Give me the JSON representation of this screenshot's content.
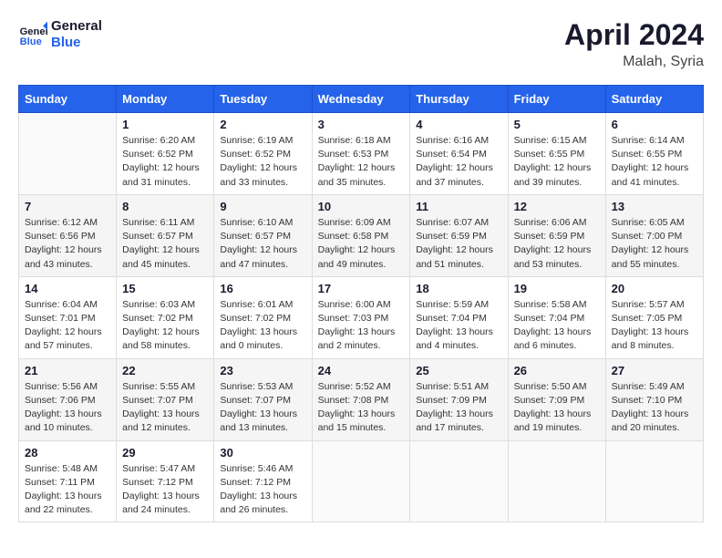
{
  "logo": {
    "line1": "General",
    "line2": "Blue"
  },
  "title": "April 2024",
  "subtitle": "Malah, Syria",
  "header_days": [
    "Sunday",
    "Monday",
    "Tuesday",
    "Wednesday",
    "Thursday",
    "Friday",
    "Saturday"
  ],
  "weeks": [
    [
      {
        "day": "",
        "info": ""
      },
      {
        "day": "1",
        "info": "Sunrise: 6:20 AM\nSunset: 6:52 PM\nDaylight: 12 hours\nand 31 minutes."
      },
      {
        "day": "2",
        "info": "Sunrise: 6:19 AM\nSunset: 6:52 PM\nDaylight: 12 hours\nand 33 minutes."
      },
      {
        "day": "3",
        "info": "Sunrise: 6:18 AM\nSunset: 6:53 PM\nDaylight: 12 hours\nand 35 minutes."
      },
      {
        "day": "4",
        "info": "Sunrise: 6:16 AM\nSunset: 6:54 PM\nDaylight: 12 hours\nand 37 minutes."
      },
      {
        "day": "5",
        "info": "Sunrise: 6:15 AM\nSunset: 6:55 PM\nDaylight: 12 hours\nand 39 minutes."
      },
      {
        "day": "6",
        "info": "Sunrise: 6:14 AM\nSunset: 6:55 PM\nDaylight: 12 hours\nand 41 minutes."
      }
    ],
    [
      {
        "day": "7",
        "info": "Sunrise: 6:12 AM\nSunset: 6:56 PM\nDaylight: 12 hours\nand 43 minutes."
      },
      {
        "day": "8",
        "info": "Sunrise: 6:11 AM\nSunset: 6:57 PM\nDaylight: 12 hours\nand 45 minutes."
      },
      {
        "day": "9",
        "info": "Sunrise: 6:10 AM\nSunset: 6:57 PM\nDaylight: 12 hours\nand 47 minutes."
      },
      {
        "day": "10",
        "info": "Sunrise: 6:09 AM\nSunset: 6:58 PM\nDaylight: 12 hours\nand 49 minutes."
      },
      {
        "day": "11",
        "info": "Sunrise: 6:07 AM\nSunset: 6:59 PM\nDaylight: 12 hours\nand 51 minutes."
      },
      {
        "day": "12",
        "info": "Sunrise: 6:06 AM\nSunset: 6:59 PM\nDaylight: 12 hours\nand 53 minutes."
      },
      {
        "day": "13",
        "info": "Sunrise: 6:05 AM\nSunset: 7:00 PM\nDaylight: 12 hours\nand 55 minutes."
      }
    ],
    [
      {
        "day": "14",
        "info": "Sunrise: 6:04 AM\nSunset: 7:01 PM\nDaylight: 12 hours\nand 57 minutes."
      },
      {
        "day": "15",
        "info": "Sunrise: 6:03 AM\nSunset: 7:02 PM\nDaylight: 12 hours\nand 58 minutes."
      },
      {
        "day": "16",
        "info": "Sunrise: 6:01 AM\nSunset: 7:02 PM\nDaylight: 13 hours\nand 0 minutes."
      },
      {
        "day": "17",
        "info": "Sunrise: 6:00 AM\nSunset: 7:03 PM\nDaylight: 13 hours\nand 2 minutes."
      },
      {
        "day": "18",
        "info": "Sunrise: 5:59 AM\nSunset: 7:04 PM\nDaylight: 13 hours\nand 4 minutes."
      },
      {
        "day": "19",
        "info": "Sunrise: 5:58 AM\nSunset: 7:04 PM\nDaylight: 13 hours\nand 6 minutes."
      },
      {
        "day": "20",
        "info": "Sunrise: 5:57 AM\nSunset: 7:05 PM\nDaylight: 13 hours\nand 8 minutes."
      }
    ],
    [
      {
        "day": "21",
        "info": "Sunrise: 5:56 AM\nSunset: 7:06 PM\nDaylight: 13 hours\nand 10 minutes."
      },
      {
        "day": "22",
        "info": "Sunrise: 5:55 AM\nSunset: 7:07 PM\nDaylight: 13 hours\nand 12 minutes."
      },
      {
        "day": "23",
        "info": "Sunrise: 5:53 AM\nSunset: 7:07 PM\nDaylight: 13 hours\nand 13 minutes."
      },
      {
        "day": "24",
        "info": "Sunrise: 5:52 AM\nSunset: 7:08 PM\nDaylight: 13 hours\nand 15 minutes."
      },
      {
        "day": "25",
        "info": "Sunrise: 5:51 AM\nSunset: 7:09 PM\nDaylight: 13 hours\nand 17 minutes."
      },
      {
        "day": "26",
        "info": "Sunrise: 5:50 AM\nSunset: 7:09 PM\nDaylight: 13 hours\nand 19 minutes."
      },
      {
        "day": "27",
        "info": "Sunrise: 5:49 AM\nSunset: 7:10 PM\nDaylight: 13 hours\nand 20 minutes."
      }
    ],
    [
      {
        "day": "28",
        "info": "Sunrise: 5:48 AM\nSunset: 7:11 PM\nDaylight: 13 hours\nand 22 minutes."
      },
      {
        "day": "29",
        "info": "Sunrise: 5:47 AM\nSunset: 7:12 PM\nDaylight: 13 hours\nand 24 minutes."
      },
      {
        "day": "30",
        "info": "Sunrise: 5:46 AM\nSunset: 7:12 PM\nDaylight: 13 hours\nand 26 minutes."
      },
      {
        "day": "",
        "info": ""
      },
      {
        "day": "",
        "info": ""
      },
      {
        "day": "",
        "info": ""
      },
      {
        "day": "",
        "info": ""
      }
    ]
  ]
}
